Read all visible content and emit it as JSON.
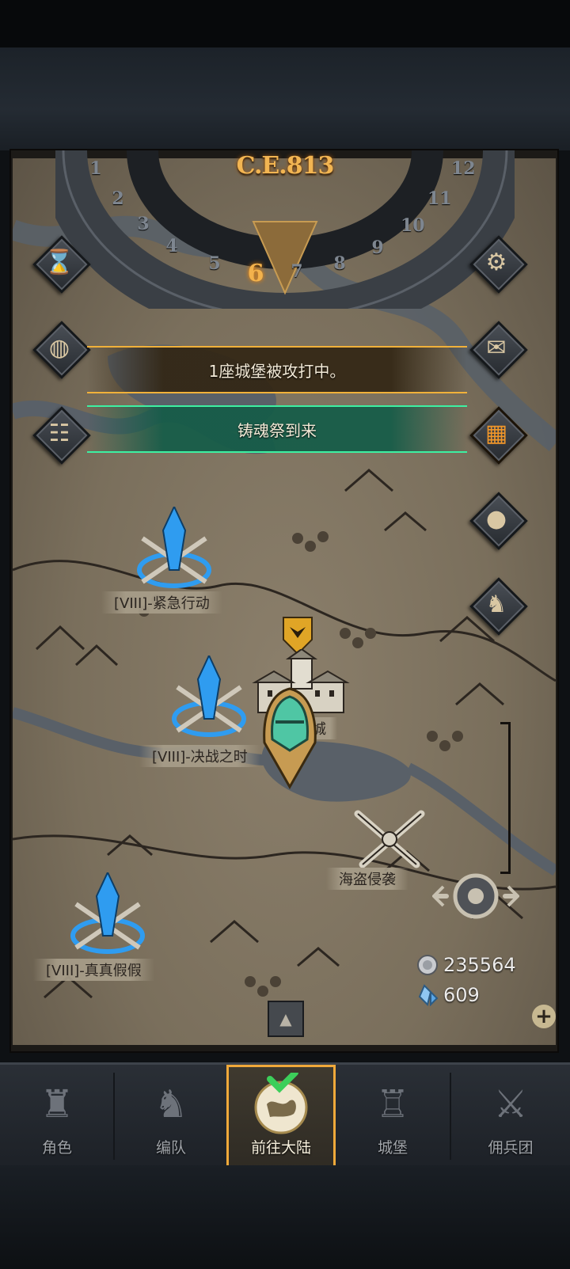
{
  "header": {
    "year_label": "C.E.813",
    "months": [
      "1",
      "2",
      "3",
      "4",
      "5",
      "6",
      "7",
      "8",
      "9",
      "10",
      "11",
      "12"
    ],
    "current_month": "6"
  },
  "banners": {
    "siege_notice": "1座城堡被攻打中。",
    "event_notice": "铸魂祭到来"
  },
  "left_buttons": [
    {
      "icon": "hourglass-icon"
    },
    {
      "icon": "money-bag-icon"
    },
    {
      "icon": "scroll-icon"
    }
  ],
  "right_buttons": [
    {
      "icon": "gear-icon"
    },
    {
      "icon": "mail-icon"
    },
    {
      "icon": "calendar-grid-icon"
    },
    {
      "icon": "coin-icon"
    },
    {
      "icon": "knight-helmet-icon"
    }
  ],
  "map": {
    "markers": [
      {
        "label": "[VIII]-紧急行动",
        "icon": "blue-crystal-icon"
      },
      {
        "label": "[VIII]-决战之时",
        "icon": "blue-crystal-icon"
      },
      {
        "label": "[VIII]-真真假假",
        "icon": "blue-crystal-icon"
      },
      {
        "label": "海盗侵袭",
        "icon": "crossed-swords-icon"
      }
    ],
    "castle_label_fragment": "城"
  },
  "resources": {
    "silver": "235564",
    "crystal": "609"
  },
  "nav": [
    {
      "label": "角色",
      "icon": "knight-icon"
    },
    {
      "label": "编队",
      "icon": "helmet-icon"
    },
    {
      "label": "前往大陆",
      "icon": "world-map-icon"
    },
    {
      "label": "城堡",
      "icon": "castle-icon"
    },
    {
      "label": "佣兵团",
      "icon": "mercenary-icon"
    }
  ],
  "active_nav": "前往大陆",
  "colors": {
    "accent_gold": "#f0a93a",
    "event_green": "#3df0a2",
    "crystal_blue": "#2f9cf0"
  }
}
